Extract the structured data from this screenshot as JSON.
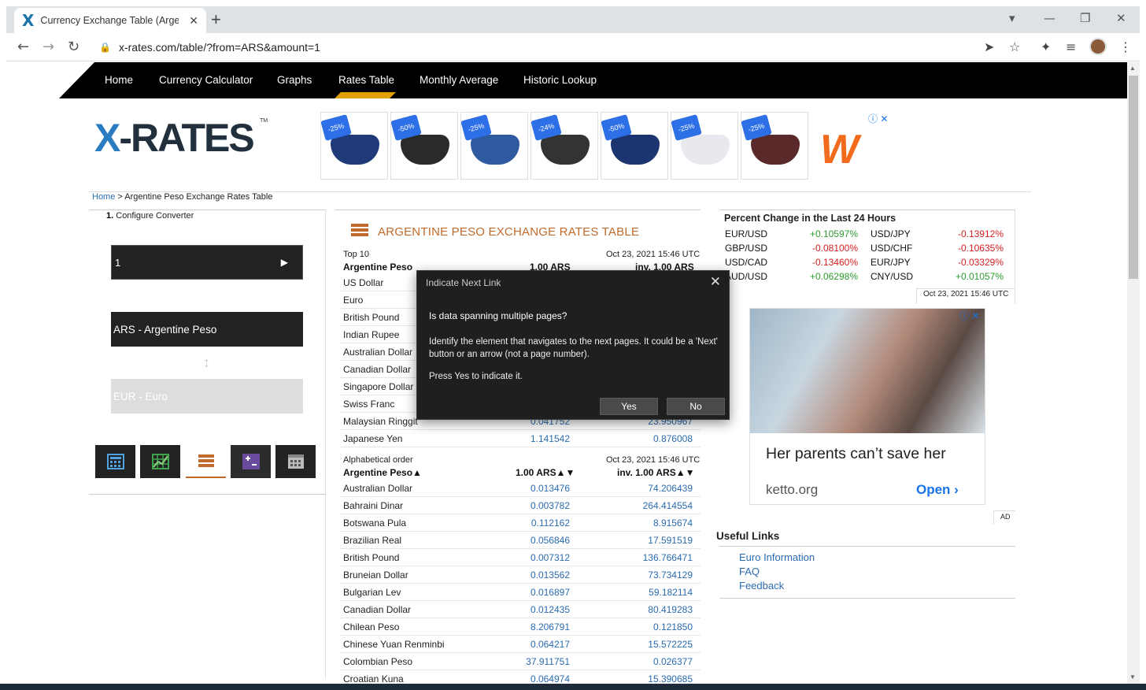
{
  "browser": {
    "tab_title": "Currency Exchange Table (Argentine Peso",
    "url": "x-rates.com/table/?from=ARS&amount=1"
  },
  "site": {
    "nav": [
      "Home",
      "Currency Calculator",
      "Graphs",
      "Rates Table",
      "Monthly Average",
      "Historic Lookup"
    ],
    "active_nav": "Rates Table",
    "logo": "X-RATES",
    "logo_tm": "TM",
    "breadcrumb_home": "Home",
    "breadcrumb_rest": " > Argentine Peso Exchange Rates Table"
  },
  "ad_masks": [
    {
      "badge": "-25%",
      "color": "#1e3a78"
    },
    {
      "badge": "-50%",
      "color": "#2a2a2a"
    },
    {
      "badge": "-25%",
      "color": "#2f5aa0"
    },
    {
      "badge": "-24%",
      "color": "#333333"
    },
    {
      "badge": "-50%",
      "color": "#1c3470"
    },
    {
      "badge": "-25%",
      "color": "#e8e8ef"
    },
    {
      "badge": "-25%",
      "color": "#5a2a2a"
    }
  ],
  "converter": {
    "step_num": "1.",
    "step_label": "Configure Converter",
    "amount": "1",
    "go": "▶",
    "from": "ARS - Argentine Peso",
    "swap": "↕",
    "to": "EUR - Euro"
  },
  "table": {
    "title": "ARGENTINE PESO EXCHANGE RATES TABLE",
    "top10_label": "Top 10",
    "date": "Oct 23, 2021 15:46 UTC",
    "col_currency": "Argentine Peso",
    "col_amount": "1.00 ARS",
    "col_inverse": "inv. 1.00 ARS",
    "top10": [
      {
        "name": "US Dollar",
        "v1": "",
        "v2": ""
      },
      {
        "name": "Euro",
        "v1": "",
        "v2": ""
      },
      {
        "name": "British Pound",
        "v1": "",
        "v2": ""
      },
      {
        "name": "Indian Rupee",
        "v1": "",
        "v2": ""
      },
      {
        "name": "Australian Dollar",
        "v1": "",
        "v2": ""
      },
      {
        "name": "Canadian Dollar",
        "v1": "",
        "v2": ""
      },
      {
        "name": "Singapore Dollar",
        "v1": "",
        "v2": ""
      },
      {
        "name": "Swiss Franc",
        "v1": "",
        "v2": ""
      },
      {
        "name": "Malaysian Ringgit",
        "v1": "0.041752",
        "v2": "23.950967"
      },
      {
        "name": "Japanese Yen",
        "v1": "1.141542",
        "v2": "0.876008"
      }
    ],
    "alpha_label": "Alphabetical order",
    "alpha_col_currency": "Argentine Peso▲",
    "alpha_col_amount": "1.00 ARS▲▼",
    "alpha_col_inverse": "inv. 1.00 ARS▲▼",
    "alpha": [
      {
        "name": "Australian Dollar",
        "v1": "0.013476",
        "v2": "74.206439"
      },
      {
        "name": "Bahraini Dinar",
        "v1": "0.003782",
        "v2": "264.414554"
      },
      {
        "name": "Botswana Pula",
        "v1": "0.112162",
        "v2": "8.915674"
      },
      {
        "name": "Brazilian Real",
        "v1": "0.056846",
        "v2": "17.591519"
      },
      {
        "name": "British Pound",
        "v1": "0.007312",
        "v2": "136.766471"
      },
      {
        "name": "Bruneian Dollar",
        "v1": "0.013562",
        "v2": "73.734129"
      },
      {
        "name": "Bulgarian Lev",
        "v1": "0.016897",
        "v2": "59.182114"
      },
      {
        "name": "Canadian Dollar",
        "v1": "0.012435",
        "v2": "80.419283"
      },
      {
        "name": "Chilean Peso",
        "v1": "8.206791",
        "v2": "0.121850"
      },
      {
        "name": "Chinese Yuan Renminbi",
        "v1": "0.064217",
        "v2": "15.572225"
      },
      {
        "name": "Colombian Peso",
        "v1": "37.911751",
        "v2": "0.026377"
      },
      {
        "name": "Croatian Kuna",
        "v1": "0.064974",
        "v2": "15.390685"
      }
    ]
  },
  "pct": {
    "title": "Percent Change in the Last 24 Hours",
    "rows": [
      {
        "p1": "EUR/USD",
        "c1": "+0.10597%",
        "s1": "pos",
        "p2": "USD/JPY",
        "c2": "-0.13912%",
        "s2": "neg"
      },
      {
        "p1": "GBP/USD",
        "c1": "-0.08100%",
        "s1": "neg",
        "p2": "USD/CHF",
        "c2": "-0.10635%",
        "s2": "neg"
      },
      {
        "p1": "USD/CAD",
        "c1": "-0.13460%",
        "s1": "neg",
        "p2": "EUR/JPY",
        "c2": "-0.03329%",
        "s2": "neg"
      },
      {
        "p1": "AUD/USD",
        "c1": "+0.06298%",
        "s1": "pos",
        "p2": "CNY/USD",
        "c2": "+0.01057%",
        "s2": "pos"
      }
    ],
    "date": "Oct 23, 2021 15:46 UTC"
  },
  "ad2": {
    "headline": "Her parents can’t save her",
    "domain": "ketto.org",
    "cta": "Open ›",
    "label": "AD"
  },
  "useful": {
    "title": "Useful Links",
    "links": [
      "Euro Information",
      "FAQ",
      "Feedback"
    ]
  },
  "dialog": {
    "title": "Indicate Next Link",
    "question": "Is data spanning multiple pages?",
    "body": "Identify the element that navigates to the next pages. It could be a 'Next' button or an arrow (not a page number).",
    "press": "Press Yes to indicate it.",
    "yes": "Yes",
    "no": "No"
  }
}
